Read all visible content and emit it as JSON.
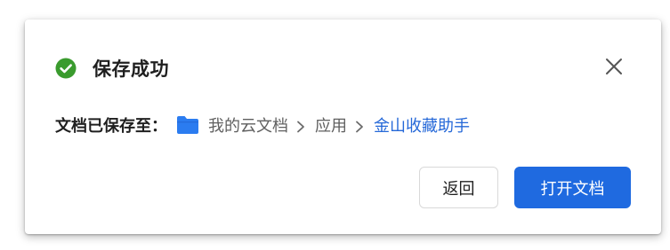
{
  "dialog": {
    "title": "保存成功",
    "status_icon": "check-circle-icon",
    "close_icon": "close-icon",
    "path_label": "文档已保存至：",
    "folder_icon": "folder-icon",
    "breadcrumb": [
      "我的云文档",
      "应用",
      "金山收藏助手"
    ],
    "buttons": {
      "back": "返回",
      "open": "打开文档"
    }
  },
  "colors": {
    "success": "#3a9b2e",
    "accent": "#1f6ae0",
    "link": "#2568d8",
    "folder": "#2b7cf0"
  }
}
